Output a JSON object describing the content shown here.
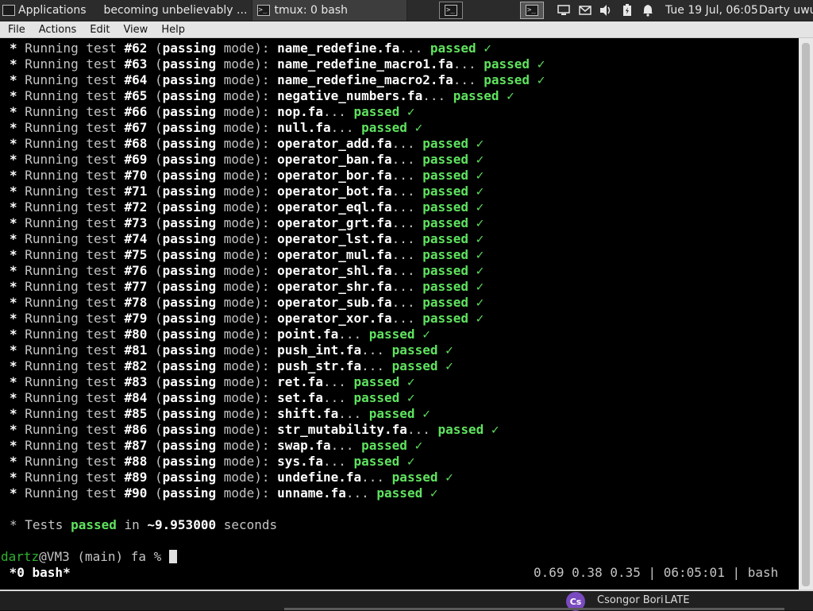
{
  "panel": {
    "apps_label": "Applications",
    "tasks": [
      "becoming unbelievably ...",
      "tmux: 0 bash"
    ],
    "clock": "Tue 19 Jul, 06:05",
    "user": "Darty uwu",
    "launcher_glyph": ">_"
  },
  "menu": [
    "File",
    "Actions",
    "Edit",
    "View",
    "Help"
  ],
  "tests": [
    [
      "#62",
      "name_redefine.fa"
    ],
    [
      "#63",
      "name_redefine_macro1.fa"
    ],
    [
      "#64",
      "name_redefine_macro2.fa"
    ],
    [
      "#65",
      "negative_numbers.fa"
    ],
    [
      "#66",
      "nop.fa"
    ],
    [
      "#67",
      "null.fa"
    ],
    [
      "#68",
      "operator_add.fa"
    ],
    [
      "#69",
      "operator_ban.fa"
    ],
    [
      "#70",
      "operator_bor.fa"
    ],
    [
      "#71",
      "operator_bot.fa"
    ],
    [
      "#72",
      "operator_eql.fa"
    ],
    [
      "#73",
      "operator_grt.fa"
    ],
    [
      "#74",
      "operator_lst.fa"
    ],
    [
      "#75",
      "operator_mul.fa"
    ],
    [
      "#76",
      "operator_shl.fa"
    ],
    [
      "#77",
      "operator_shr.fa"
    ],
    [
      "#78",
      "operator_sub.fa"
    ],
    [
      "#79",
      "operator_xor.fa"
    ],
    [
      "#80",
      "point.fa"
    ],
    [
      "#81",
      "push_int.fa"
    ],
    [
      "#82",
      "push_str.fa"
    ],
    [
      "#83",
      "ret.fa"
    ],
    [
      "#84",
      "set.fa"
    ],
    [
      "#85",
      "shift.fa"
    ],
    [
      "#86",
      "str_mutability.fa"
    ],
    [
      "#87",
      "swap.fa"
    ],
    [
      "#88",
      "sys.fa"
    ],
    [
      "#89",
      "undefine.fa"
    ],
    [
      "#90",
      "unname.fa"
    ]
  ],
  "line_parts": {
    "bullet": "* ",
    "running": "Running test ",
    "open": " (",
    "mode": "passing",
    "mode_word": " mode): ",
    "ellipsis": "... ",
    "passed": "passed",
    "check": " ✓"
  },
  "summary": {
    "prefix": "* Tests ",
    "passed": "passed",
    "in": " in ",
    "time": "~9.953000",
    "suffix": " seconds"
  },
  "prompt": {
    "user": "dartz",
    "rest": "@VM3 (main) fa % "
  },
  "tmux": {
    "window": " *0 bash*",
    "status": "0.69 0.38 0.35 | 06:05:01 | bash"
  },
  "bottom": {
    "avatar": "Cs",
    "name": "Csongor Bori",
    "status": "LATE"
  },
  "colors": {
    "passed": "#5fe35f",
    "terminal_bg": "#000000",
    "panel_bg": "#2b2b2b"
  }
}
